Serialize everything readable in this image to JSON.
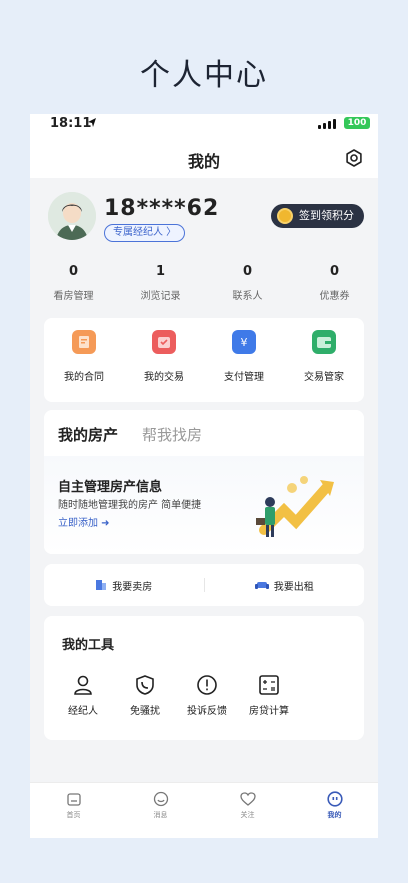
{
  "page_heading": "个人中心",
  "status_bar": {
    "time": "18:11",
    "battery": "100"
  },
  "nav": {
    "title": "我的"
  },
  "profile": {
    "username": "18****62",
    "agent_tag": "专属经纪人 〉",
    "signin_label": "签到领积分"
  },
  "stats": [
    {
      "value": "0",
      "label": "看房管理"
    },
    {
      "value": "1",
      "label": "浏览记录"
    },
    {
      "value": "0",
      "label": "联系人"
    },
    {
      "value": "0",
      "label": "优惠券"
    }
  ],
  "shortcuts": [
    {
      "label": "我的合同",
      "icon": "contract-icon",
      "color": "#f59a57"
    },
    {
      "label": "我的交易",
      "icon": "transaction-icon",
      "color": "#ec5d5d"
    },
    {
      "label": "支付管理",
      "icon": "payment-icon",
      "color": "#3f7ae8"
    },
    {
      "label": "交易管家",
      "icon": "wallet-icon",
      "color": "#2fae6a"
    }
  ],
  "property": {
    "tab_active": "我的房产",
    "tab_other": "帮我找房",
    "title": "自主管理房产信息",
    "subtitle": "随时随地管理我的房产 简单便捷",
    "add_link": "立即添加 ➜"
  },
  "sell_rent": {
    "sell": "我要卖房",
    "rent": "我要出租"
  },
  "tools": {
    "title": "我的工具",
    "items": [
      {
        "label": "经纪人",
        "icon": "agent-icon"
      },
      {
        "label": "免骚扰",
        "icon": "phone-shield-icon"
      },
      {
        "label": "投诉反馈",
        "icon": "alert-icon"
      },
      {
        "label": "房贷计算",
        "icon": "calculator-icon"
      }
    ]
  },
  "tabbar": [
    {
      "label": "首页",
      "icon": "home-icon"
    },
    {
      "label": "消息",
      "icon": "message-icon"
    },
    {
      "label": "关注",
      "icon": "heart-icon"
    },
    {
      "label": "我的",
      "icon": "profile-icon",
      "active": true
    }
  ],
  "colors": {
    "accent": "#3a5bb8",
    "signin_bg": "#2b3243",
    "battery": "#34c759"
  }
}
